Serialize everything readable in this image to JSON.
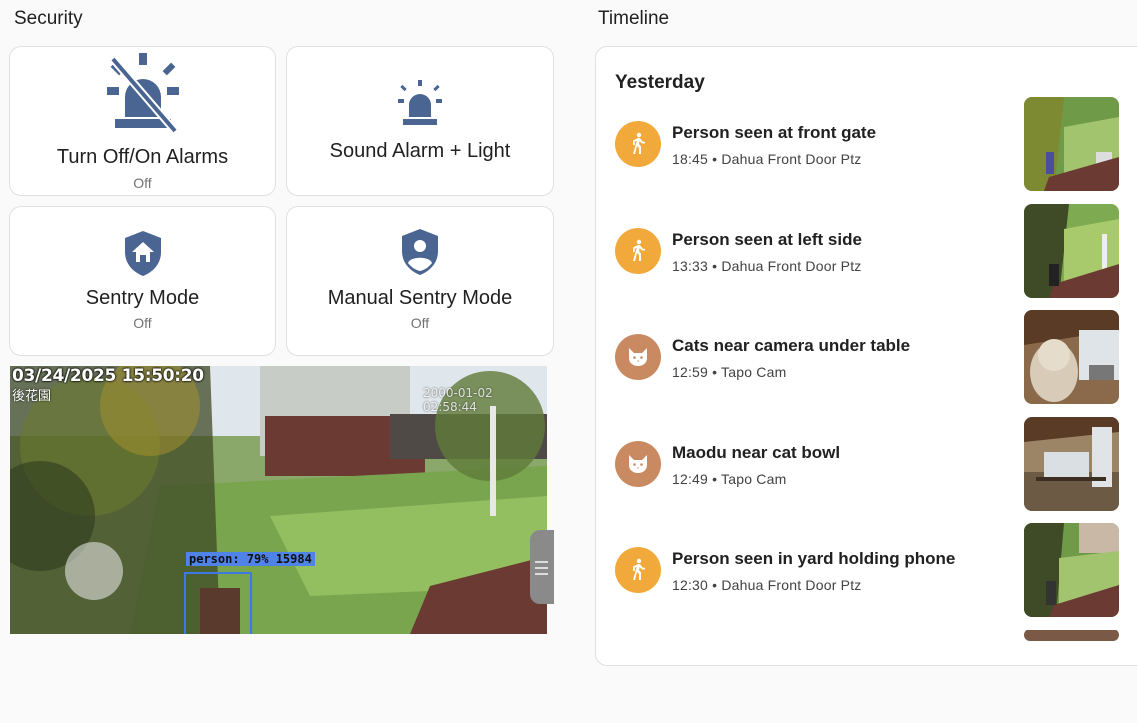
{
  "security": {
    "title": "Security",
    "cards": [
      {
        "label": "Turn Off/On Alarms",
        "state": "Off",
        "icon": "alarm-light-off-icon"
      },
      {
        "label": "Sound Alarm + Light",
        "state": "",
        "icon": "alarm-light-icon"
      },
      {
        "label": "Sentry Mode",
        "state": "Off",
        "icon": "shield-home-icon"
      },
      {
        "label": "Manual Sentry Mode",
        "state": "Off",
        "icon": "shield-account-icon"
      }
    ],
    "camera": {
      "timestamp": "03/24/2025  15:50:20",
      "overlay_name": "後花園",
      "secondary_timestamp": "2000-01-02 02:58:44",
      "detection_label": "person: 79% 15984"
    }
  },
  "timeline": {
    "title": "Timeline",
    "day": "Yesterday",
    "events": [
      {
        "title": "Person seen at front gate",
        "time": "18:45",
        "camera": "Dahua Front Door Ptz",
        "meta": "18:45 • Dahua Front Door Ptz",
        "icon": "walk-icon",
        "color": "#f2a93b"
      },
      {
        "title": "Person seen at left side",
        "time": "13:33",
        "camera": "Dahua Front Door Ptz",
        "meta": "13:33 • Dahua Front Door Ptz",
        "icon": "walk-icon",
        "color": "#f2a93b"
      },
      {
        "title": "Cats near camera under table",
        "time": "12:59",
        "camera": "Tapo Cam",
        "meta": "12:59 • Tapo Cam",
        "icon": "cat-icon",
        "color": "#c98a62"
      },
      {
        "title": "Maodu near cat bowl",
        "time": "12:49",
        "camera": "Tapo Cam",
        "meta": "12:49 • Tapo Cam",
        "icon": "cat-icon",
        "color": "#c98a62"
      },
      {
        "title": "Person seen in yard holding phone",
        "time": "12:30",
        "camera": "Dahua Front Door Ptz",
        "meta": "12:30 • Dahua Front Door Ptz",
        "icon": "walk-icon",
        "color": "#f2a93b"
      }
    ]
  },
  "colors": {
    "icon_blue": "#4a6591",
    "person_badge": "#f2a93b",
    "cat_badge": "#c98a62",
    "detection_box": "#3c79e6"
  }
}
